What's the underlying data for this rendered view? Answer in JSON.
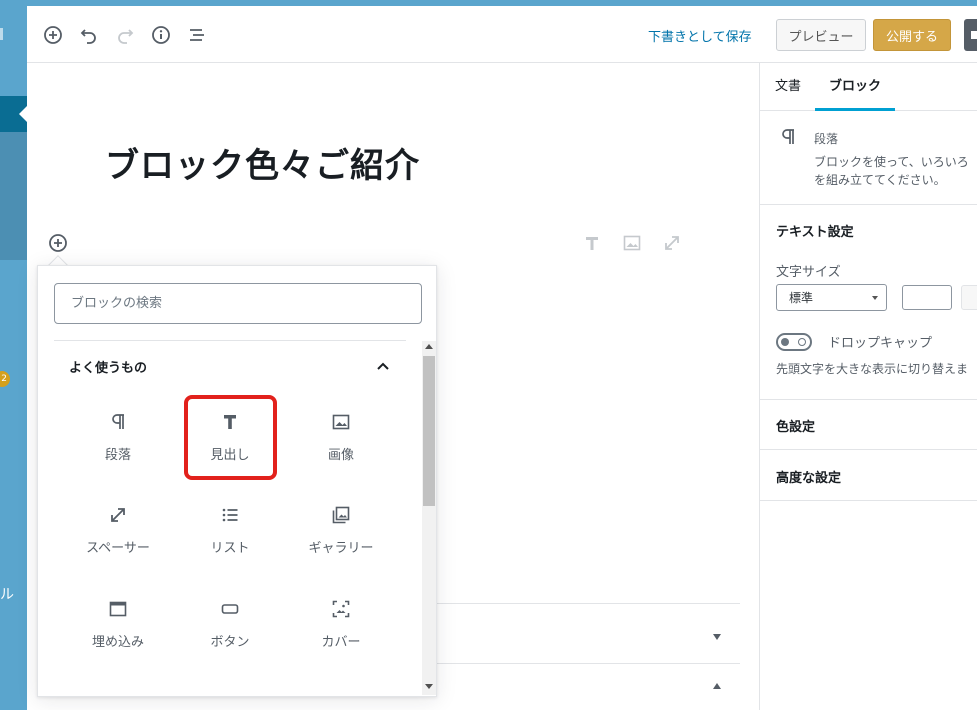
{
  "admin_menu": {
    "badge_count": "2",
    "partial_label": "ル"
  },
  "header": {
    "save_draft": "下書きとして保存",
    "preview": "プレビュー",
    "publish": "公開する"
  },
  "post": {
    "title": "ブロック色々ご紹介"
  },
  "inserter": {
    "search_placeholder": "ブロックの検索",
    "panel_title": "よく使うもの",
    "blocks": [
      {
        "label": "段落",
        "icon": "paragraph-icon"
      },
      {
        "label": "見出し",
        "icon": "heading-icon",
        "highlighted": true
      },
      {
        "label": "画像",
        "icon": "image-icon"
      },
      {
        "label": "スペーサー",
        "icon": "spacer-icon"
      },
      {
        "label": "リスト",
        "icon": "list-icon"
      },
      {
        "label": "ギャラリー",
        "icon": "gallery-icon"
      },
      {
        "label": "埋め込み",
        "icon": "embed-icon"
      },
      {
        "label": "ボタン",
        "icon": "button-icon"
      },
      {
        "label": "カバー",
        "icon": "cover-icon"
      }
    ]
  },
  "sidebar": {
    "tabs": [
      {
        "label": "文書",
        "active": false
      },
      {
        "label": "ブロック",
        "active": true
      }
    ],
    "block_card": {
      "title": "段落",
      "description_line1": "ブロックを使って、いろいろ",
      "description_line2": "を組み立ててください。"
    },
    "text_settings": {
      "title": "テキスト設定",
      "font_size_label": "文字サイズ",
      "font_size_value": "標準",
      "drop_cap_label": "ドロップキャップ",
      "drop_cap_help": "先頭文字を大きな表示に切り替えま"
    },
    "color_settings": {
      "title": "色設定"
    },
    "advanced": {
      "title": "高度な設定"
    }
  },
  "colors": {
    "accent": "#0073aa",
    "publish": "#d5a748",
    "highlight": "#e2211c",
    "tab_underline": "#00a0d2"
  }
}
